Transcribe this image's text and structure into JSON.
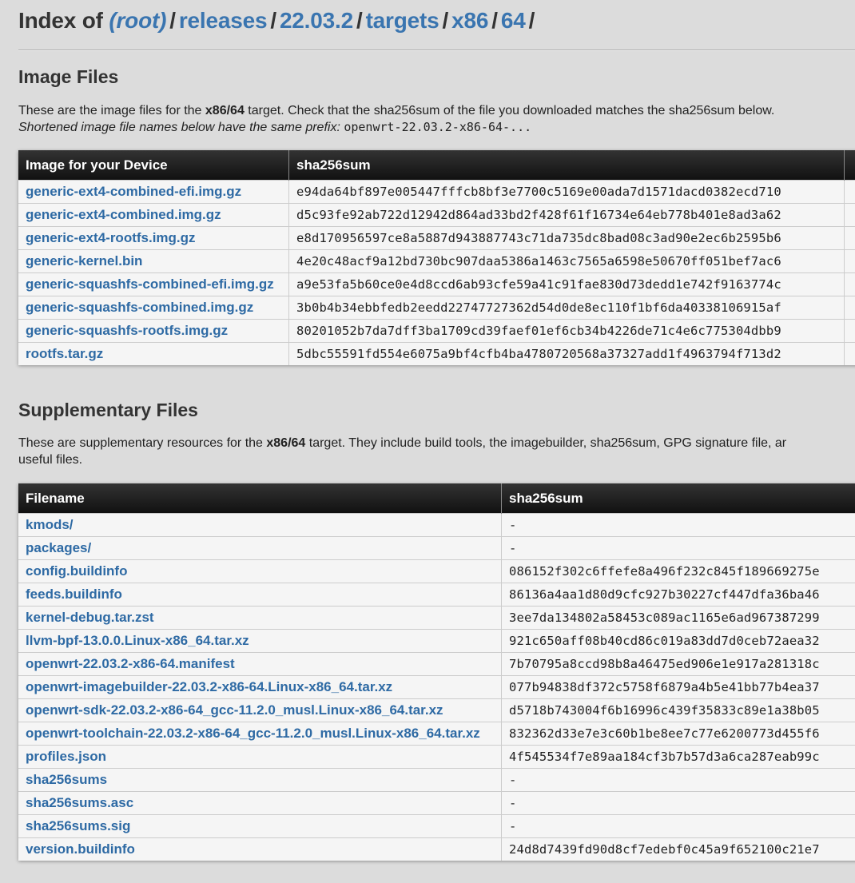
{
  "header": {
    "prefix": "Index of",
    "root": "(root)",
    "sep": "/",
    "crumbs": [
      "releases",
      "22.03.2",
      "targets",
      "x86",
      "64"
    ],
    "trailing": "/"
  },
  "image_section": {
    "title": "Image Files",
    "desc_1": "These are the image files for the ",
    "target": "x86/64",
    "desc_2": " target. Check that the sha256sum of the file you downloaded matches the sha256sum below.",
    "desc_italic": "Shortened image file names below have the same prefix: ",
    "prefix_code": "openwrt-22.03.2-x86-64-...",
    "col_file": "Image for your Device",
    "col_sha": "sha256sum",
    "rows": [
      {
        "name": "generic-ext4-combined-efi.img.gz",
        "sha": "e94da64bf897e005447fffcb8bf3e7700c5169e00ada7d1571dacd0382ecd710"
      },
      {
        "name": "generic-ext4-combined.img.gz",
        "sha": "d5c93fe92ab722d12942d864ad33bd2f428f61f16734e64eb778b401e8ad3a62"
      },
      {
        "name": "generic-ext4-rootfs.img.gz",
        "sha": "e8d170956597ce8a5887d943887743c71da735dc8bad08c3ad90e2ec6b2595b6"
      },
      {
        "name": "generic-kernel.bin",
        "sha": "4e20c48acf9a12bd730bc907daa5386a1463c7565a6598e50670ff051bef7ac6"
      },
      {
        "name": "generic-squashfs-combined-efi.img.gz",
        "sha": "a9e53fa5b60ce0e4d8ccd6ab93cfe59a41c91fae830d73dedd1e742f9163774c"
      },
      {
        "name": "generic-squashfs-combined.img.gz",
        "sha": "3b0b4b34ebbfedb2eedd22747727362d54d0de8ec110f1bf6da40338106915af"
      },
      {
        "name": "generic-squashfs-rootfs.img.gz",
        "sha": "80201052b7da7dff3ba1709cd39faef01ef6cb34b4226de71c4e6c775304dbb9"
      },
      {
        "name": "rootfs.tar.gz",
        "sha": "5dbc55591fd554e6075a9bf4cfb4ba4780720568a37327add1f4963794f713d2"
      }
    ]
  },
  "supp_section": {
    "title": "Supplementary Files",
    "desc_1": "These are supplementary resources for the ",
    "target": "x86/64",
    "desc_2": " target. They include build tools, the imagebuilder, sha256sum, GPG signature file, ar",
    "desc_3": "useful files.",
    "col_file": "Filename",
    "col_sha": "sha256sum",
    "rows": [
      {
        "name": "kmods/",
        "sha": "-"
      },
      {
        "name": "packages/",
        "sha": "-"
      },
      {
        "name": "config.buildinfo",
        "sha": "086152f302c6ffefe8a496f232c845f189669275e"
      },
      {
        "name": "feeds.buildinfo",
        "sha": "86136a4aa1d80d9cfc927b30227cf447dfa36ba46"
      },
      {
        "name": "kernel-debug.tar.zst",
        "sha": "3ee7da134802a58453c089ac1165e6ad967387299"
      },
      {
        "name": "llvm-bpf-13.0.0.Linux-x86_64.tar.xz",
        "sha": "921c650aff08b40cd86c019a83dd7d0ceb72aea32"
      },
      {
        "name": "openwrt-22.03.2-x86-64.manifest",
        "sha": "7b70795a8ccd98b8a46475ed906e1e917a281318c"
      },
      {
        "name": "openwrt-imagebuilder-22.03.2-x86-64.Linux-x86_64.tar.xz",
        "sha": "077b94838df372c5758f6879a4b5e41bb77b4ea37"
      },
      {
        "name": "openwrt-sdk-22.03.2-x86-64_gcc-11.2.0_musl.Linux-x86_64.tar.xz",
        "sha": "d5718b743004f6b16996c439f35833c89e1a38b05"
      },
      {
        "name": "openwrt-toolchain-22.03.2-x86-64_gcc-11.2.0_musl.Linux-x86_64.tar.xz",
        "sha": "832362d33e7e3c60b1be8ee7c77e6200773d455f6"
      },
      {
        "name": "profiles.json",
        "sha": "4f545534f7e89aa184cf3b7b57d3a6ca287eab99c"
      },
      {
        "name": "sha256sums",
        "sha": "-"
      },
      {
        "name": "sha256sums.asc",
        "sha": "-"
      },
      {
        "name": "sha256sums.sig",
        "sha": "-"
      },
      {
        "name": "version.buildinfo",
        "sha": "24d8d7439fd90d8cf7edebf0c45a9f652100c21e7"
      }
    ]
  }
}
